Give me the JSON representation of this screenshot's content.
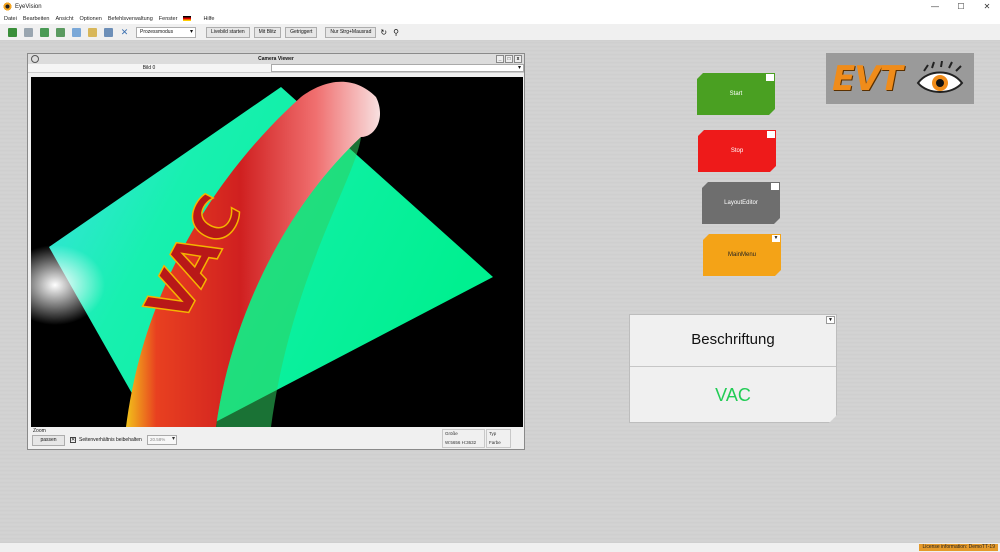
{
  "window": {
    "title": "EyeVision",
    "controls": [
      "—",
      "☐",
      "✕"
    ]
  },
  "menu": {
    "items": [
      "Datei",
      "Bearbeiten",
      "Ansicht",
      "Optionen",
      "Befehlsverwaltung",
      "Fenster",
      "Hilfe"
    ]
  },
  "toolbar": {
    "icons": [
      "run-icon",
      "step-icon",
      "import-icon",
      "export-icon",
      "new-icon",
      "open-icon",
      "copy-icon",
      "delete-icon"
    ],
    "mode_select": "Prozessmodus",
    "buttons": [
      "Livebild starten",
      "Mit Blitz",
      "Getriggert"
    ],
    "shortcut_button": "Nur Strg+Mausrad"
  },
  "camera_viewer": {
    "title": "Camera Viewer",
    "header_label": "Bild 0",
    "zoom_label": "Zoom",
    "fit_button": "passen",
    "aspect_label": "Seitenverhältnis beibehalten",
    "aspect_checked": "✕",
    "zoom_value": "20.58%",
    "size_label": "Größe",
    "size_value": "W:5656 H:3632",
    "type_label": "Typ",
    "type_value": "Farbe",
    "image_text": "VAC"
  },
  "actions": {
    "start": "Start",
    "stop": "Stop",
    "layout": "LayoutEditor",
    "main": "MainMenu",
    "corner": "▼"
  },
  "logo": {
    "text": "EVT"
  },
  "label_panel": {
    "title": "Beschriftung",
    "value": "VAC",
    "value_color": "#22cc55"
  },
  "status": {
    "license": "License information: DemoTT-19"
  },
  "colors": {
    "start": "#4aa022",
    "stop": "#ee1a1a",
    "layout": "#6e6e6e",
    "main": "#f4a317",
    "logo_orange": "#f08c1a"
  }
}
